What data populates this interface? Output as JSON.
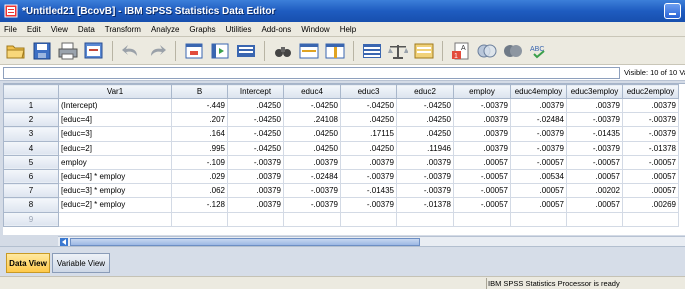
{
  "window": {
    "title": "*Untitled21 [BcovB] - IBM SPSS Statistics Data Editor"
  },
  "menu": [
    "File",
    "Edit",
    "View",
    "Data",
    "Transform",
    "Analyze",
    "Graphs",
    "Utilities",
    "Add-ons",
    "Window",
    "Help"
  ],
  "cell_editor": {
    "visible_text": "Visible: 10 of 10 Va"
  },
  "grid": {
    "columns": [
      "Var1",
      "B",
      "Intercept",
      "educ4",
      "educ3",
      "educ2",
      "employ",
      "educ4employ",
      "educ3employ",
      "educ2employ"
    ],
    "rows": [
      [
        "(Intercept)",
        "-.449",
        ".04250",
        "-.04250",
        "-.04250",
        "-.04250",
        "-.00379",
        ".00379",
        ".00379",
        ".00379"
      ],
      [
        "[educ=4]",
        ".207",
        "-.04250",
        ".24108",
        ".04250",
        ".04250",
        ".00379",
        "-.02484",
        "-.00379",
        "-.00379"
      ],
      [
        "[educ=3]",
        ".164",
        "-.04250",
        ".04250",
        ".17115",
        ".04250",
        ".00379",
        "-.00379",
        "-.01435",
        "-.00379"
      ],
      [
        "[educ=2]",
        ".995",
        "-.04250",
        ".04250",
        ".04250",
        ".11946",
        ".00379",
        "-.00379",
        "-.00379",
        "-.01378"
      ],
      [
        "employ",
        "-.109",
        "-.00379",
        ".00379",
        ".00379",
        ".00379",
        ".00057",
        "-.00057",
        "-.00057",
        "-.00057"
      ],
      [
        "[educ=4] * employ",
        ".029",
        ".00379",
        "-.02484",
        "-.00379",
        "-.00379",
        "-.00057",
        ".00534",
        ".00057",
        ".00057"
      ],
      [
        "[educ=3] * employ",
        ".062",
        ".00379",
        "-.00379",
        "-.01435",
        "-.00379",
        "-.00057",
        ".00057",
        ".00202",
        ".00057"
      ],
      [
        "[educ=2] * employ",
        "-.128",
        ".00379",
        "-.00379",
        "-.00379",
        "-.01378",
        "-.00057",
        ".00057",
        ".00057",
        ".00269"
      ]
    ],
    "row_numbers": [
      "1",
      "2",
      "3",
      "4",
      "5",
      "6",
      "7",
      "8",
      "9"
    ]
  },
  "tabs": {
    "data_view": "Data View",
    "variable_view": "Variable View"
  },
  "status": {
    "text": "IBM SPSS Statistics Processor is ready"
  },
  "colors": {
    "titlebar": "#1f5cc0",
    "active_tab": "#ffc94a"
  }
}
